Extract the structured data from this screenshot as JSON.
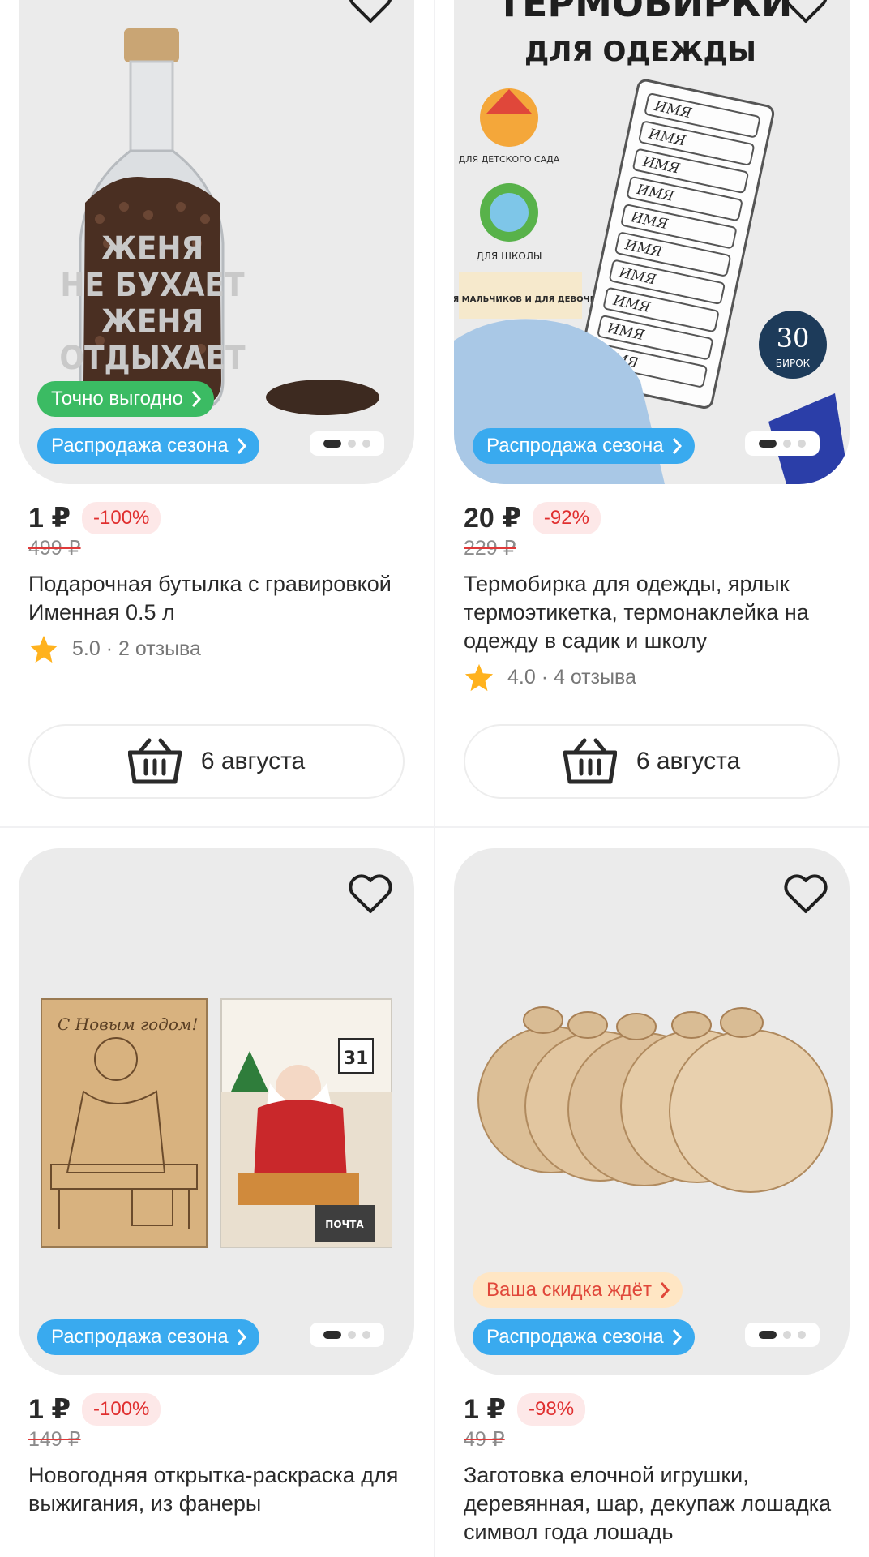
{
  "products": [
    {
      "price": "1 ₽",
      "discount": "-100%",
      "old_price": "499 ₽",
      "title": "Подарочная бутылка с гравировкой Именная  0.5 л",
      "rating": "5.0 · 2 отзыва",
      "chips": [
        "Точно выгодно",
        "Распродажа сезона"
      ],
      "delivery": "6 августа",
      "image_text": [
        "ЖЕНЯ",
        "НЕ БУХАЕТ",
        "ЖЕНЯ",
        "ОТДЫХАЕТ"
      ]
    },
    {
      "price": "20 ₽",
      "discount": "-92%",
      "old_price": "229 ₽",
      "title": "Термобирка для одежды, ярлык термоэтикетка, термонаклейка на одежду в садик и школу",
      "rating": "4.0 · 4 отзыва",
      "chips": [
        "Распродажа сезона"
      ],
      "delivery": "6 августа",
      "image_text": {
        "headline": "ТЕРМОБИРКИ",
        "subline": "ДЛЯ ОДЕЖДЫ",
        "kindergarten": "ДЛЯ ДЕТСКОГО САДА",
        "school": "ДЛЯ ШКОЛЫ",
        "gender": "ДЛЯ МАЛЬЧИКОВ И ДЛЯ ДЕВОЧЕК",
        "name_tag": "ИМЯ",
        "count": "30",
        "count_label": "БИРОК"
      }
    },
    {
      "price": "1 ₽",
      "discount": "-100%",
      "old_price": "149 ₽",
      "title": "Новогодняя открытка-раскраска для выжигания, из фанеры",
      "chips": [
        "Распродажа сезона"
      ],
      "image_text": {
        "greeting": "С Новым годом!",
        "date": "31",
        "mail": "ПОЧТА"
      }
    },
    {
      "price": "1 ₽",
      "discount": "-98%",
      "old_price": "49 ₽",
      "title": "Заготовка елочной игрушки, деревянная, шар, декупаж лошадка символ года лошадь",
      "chips": [
        "Ваша скидка ждёт",
        "Распродажа сезона"
      ]
    }
  ],
  "icons": {
    "favorite": "heart-outline-icon",
    "cart": "basket-icon",
    "rating": "star-icon",
    "chip_arrow": "chevron-right-icon"
  },
  "colors": {
    "sale_chip": "#39aaef",
    "good_deal_chip": "#3bbb63",
    "discount_waiting_chip": "#ffe6c4",
    "discount_badge_text": "#e02f2f",
    "star": "#ffb21e"
  },
  "gallery": {
    "pages": 3,
    "active_page": 1
  }
}
